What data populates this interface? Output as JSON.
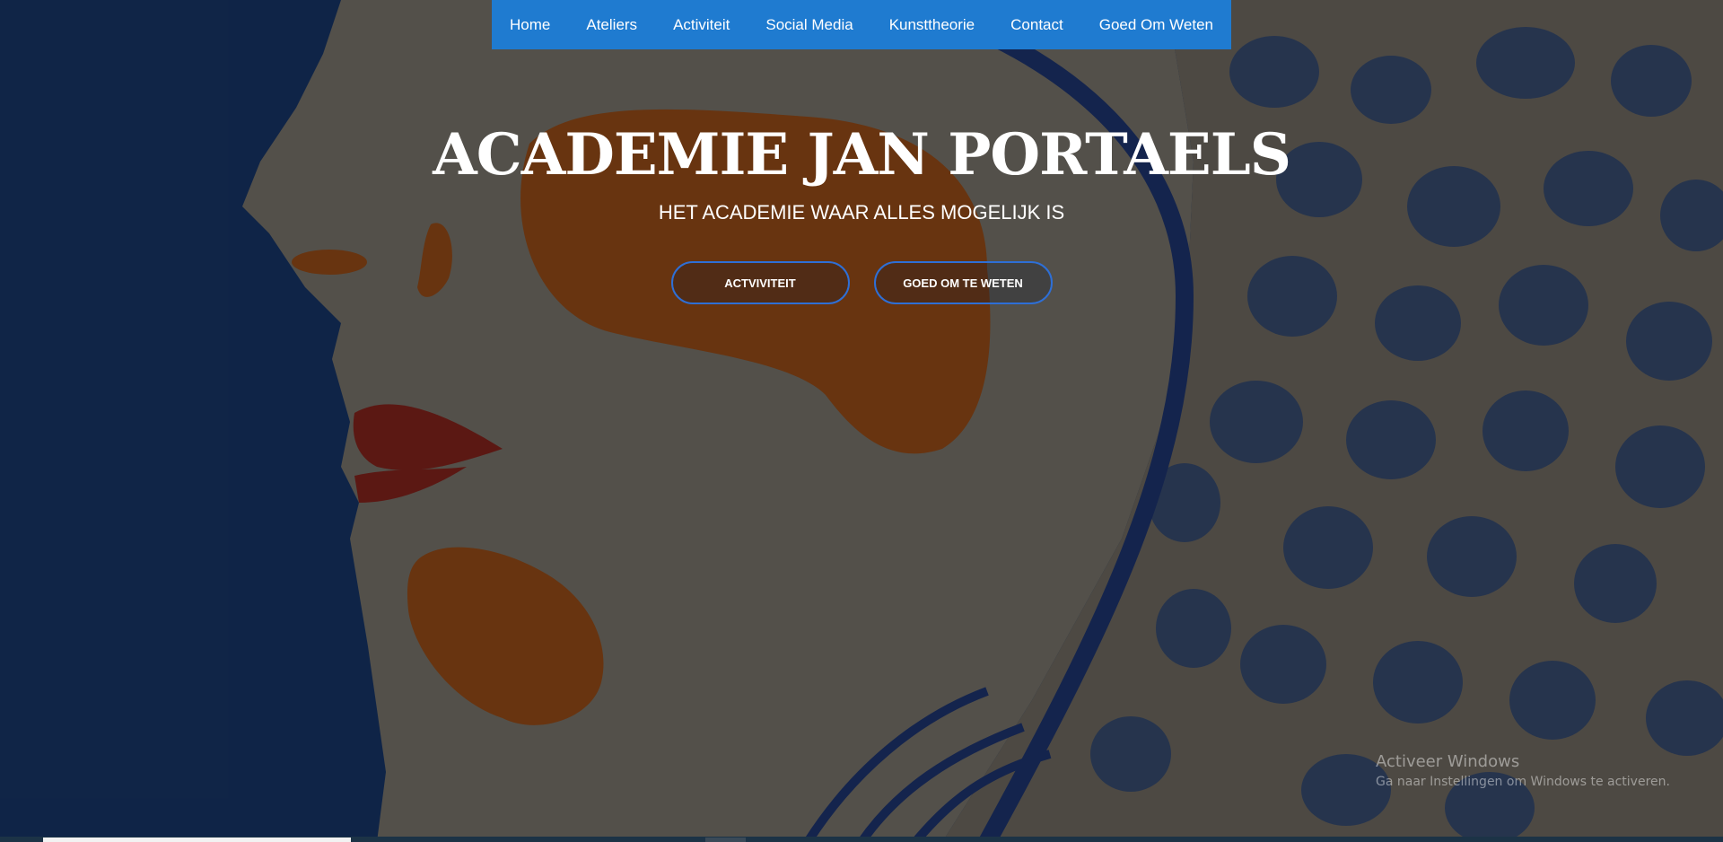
{
  "nav": {
    "items": [
      {
        "label": "Home"
      },
      {
        "label": "Ateliers"
      },
      {
        "label": "Activiteit"
      },
      {
        "label": "Social Media"
      },
      {
        "label": "Kunsttheorie"
      },
      {
        "label": "Contact"
      },
      {
        "label": "Goed Om Weten"
      }
    ],
    "background": "#1f7bd0"
  },
  "hero": {
    "title": "ACADEMIE JAN PORTAELS",
    "subtitle": "HET ACADEMIE WAAR ALLES MOGELIJK IS",
    "buttons": [
      {
        "label": "ACTVIVITEIT"
      },
      {
        "label": "GOED OM TE WETEN"
      }
    ],
    "button_border": "#2e6fd6"
  },
  "windows_watermark": {
    "title": "Activeer Windows",
    "subtitle": "Ga naar Instellingen om Windows te activeren."
  }
}
